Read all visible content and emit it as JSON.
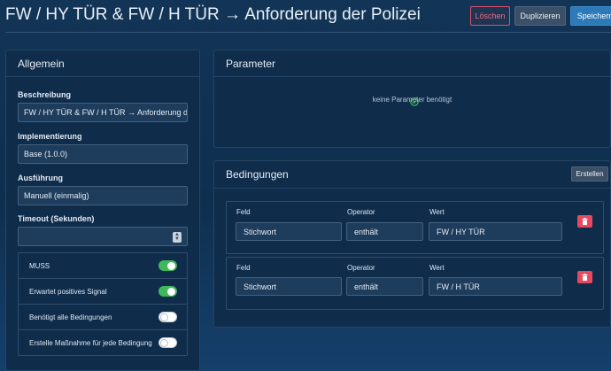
{
  "header": {
    "title": "FW / HY TÜR & FW / H TÜR → Anforderung der Polizei",
    "delete_label": "Löschen",
    "duplicate_label": "Duplizieren",
    "save_label": "Speichern"
  },
  "general": {
    "heading": "Allgemein",
    "description_label": "Beschreibung",
    "description_value": "FW / HY TÜR & FW / H TÜR → Anforderung der Polizei",
    "implementation_label": "Implementierung",
    "implementation_value": "Base (1.0.0)",
    "execution_label": "Ausführung",
    "execution_value": "Manuell (einmalig)",
    "timeout_label": "Timeout (Sekunden)",
    "timeout_value": "",
    "toggles": [
      {
        "label": "MUSS",
        "on": true
      },
      {
        "label": "Erwartet positives Signal",
        "on": true
      },
      {
        "label": "Benötigt alle Bedingungen",
        "on": false
      },
      {
        "label": "Erstelle Maßnahme für jede Bedingung",
        "on": false
      }
    ]
  },
  "parameters": {
    "heading": "Parameter",
    "empty_text": "keine Parameter benötigt"
  },
  "conditions": {
    "heading": "Bedingungen",
    "add_label": "Erstellen",
    "items": [
      {
        "field_label": "Feld",
        "field_value": "Stichwort",
        "operator_label": "Operator",
        "operator_value": "enthält",
        "value_label": "Wert",
        "value": "FW / HY TÜR"
      },
      {
        "field_label": "Feld",
        "field_value": "Stichwort",
        "operator_label": "Operator",
        "operator_value": "enthält",
        "value_label": "Wert",
        "value": "FW / H TÜR"
      }
    ]
  },
  "colors": {
    "accent": "#2e7ab8",
    "toggle_on": "#3fb85a",
    "danger": "#e8495e",
    "success": "#3fb85a"
  }
}
